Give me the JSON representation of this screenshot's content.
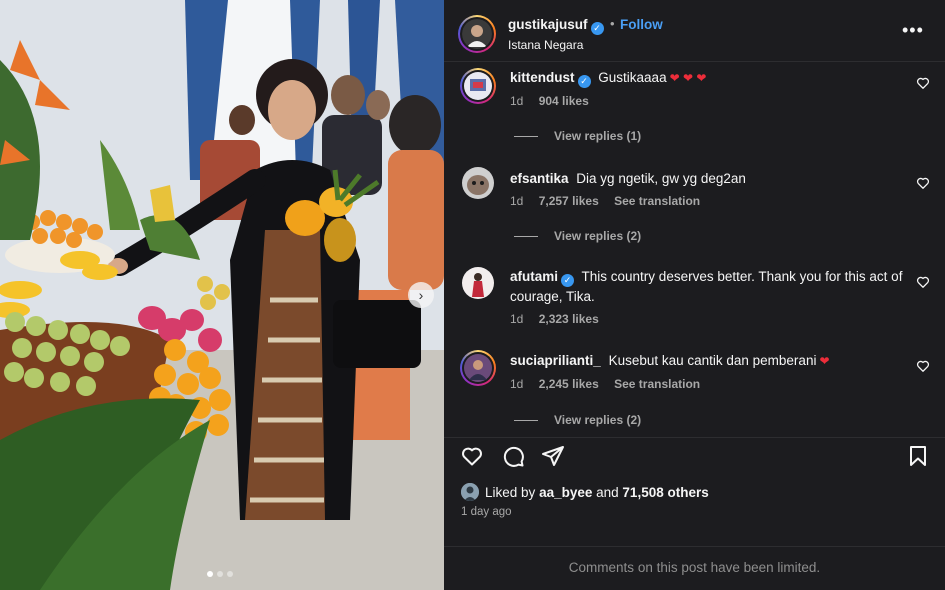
{
  "post": {
    "username": "gustikajusuf",
    "follow_label": "Follow",
    "separator": "•",
    "location": "Istana Negara",
    "more_label": "•••",
    "carousel_next": "›"
  },
  "comments": [
    {
      "username": "kittendust",
      "verified": true,
      "text": "Gustikaaaa",
      "hearts": "❤ ❤ ❤",
      "age": "1d",
      "likes": "904 likes",
      "translate": "",
      "replies": "View replies (1)"
    },
    {
      "username": "efsantika",
      "verified": false,
      "text": "Dia yg ngetik, gw yg deg2an",
      "hearts": "",
      "age": "1d",
      "likes": "7,257 likes",
      "translate": "See translation",
      "replies": "View replies (2)"
    },
    {
      "username": "afutami",
      "verified": true,
      "text": "This country deserves better. Thank you for this act of courage, Tika.",
      "hearts": "",
      "age": "1d",
      "likes": "2,323 likes",
      "translate": "",
      "replies": ""
    },
    {
      "username": "suciaprilianti_",
      "verified": false,
      "text": "Kusebut kau cantik dan pemberani",
      "hearts": "❤",
      "age": "1d",
      "likes": "2,245 likes",
      "translate": "See translation",
      "replies": "View replies (2)"
    }
  ],
  "likes": {
    "prefix": "Liked by",
    "user": "aa_byee",
    "conj": "and",
    "others": "71,508 others"
  },
  "time_ago": "1 day ago",
  "limited_notice": "Comments on this post have been limited.",
  "colors": {
    "panel_bg": "#1c1c1f",
    "accent": "#4a9ff5",
    "verified": "#3897f0",
    "heart": "#ed2d3a",
    "muted": "#a8a8a8"
  },
  "icons": [
    "verified-icon",
    "more-icon",
    "heart-outline-icon",
    "comment-icon",
    "share-icon",
    "bookmark-icon",
    "chevron-right-icon"
  ]
}
